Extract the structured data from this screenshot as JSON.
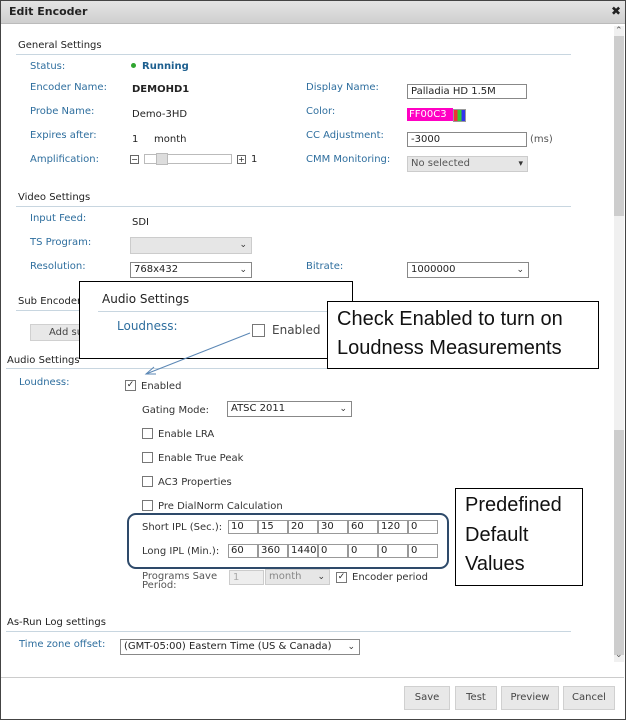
{
  "dialog": {
    "title": "Edit Encoder",
    "close_icon": "close-icon"
  },
  "general": {
    "title": "General Settings",
    "status_label": "Status:",
    "status_value": "Running",
    "status_color": "#2fa52f",
    "encoder_name_label": "Encoder Name:",
    "encoder_name_value": "DEMOHD1",
    "probe_name_label": "Probe Name:",
    "probe_name_value": "Demo-3HD",
    "expires_label": "Expires after:",
    "expires_value": "1",
    "expires_unit": "month",
    "amplification_label": "Amplification:",
    "amplification_value": "1",
    "display_name_label": "Display Name:",
    "display_name_value": "Palladia HD 1.5M",
    "color_label": "Color:",
    "color_value": "FF00C3",
    "color_hex": "#ff00c3",
    "cc_label": "CC Adjustment:",
    "cc_value": "-3000",
    "cc_unit": "(ms)",
    "cmm_label": "CMM Monitoring:",
    "cmm_value": "No selected"
  },
  "video": {
    "title": "Video Settings",
    "input_feed_label": "Input Feed:",
    "input_feed_value": "SDI",
    "ts_program_label": "TS Program:",
    "ts_program_value": "",
    "resolution_label": "Resolution:",
    "resolution_value": "768x432",
    "bitrate_label": "Bitrate:",
    "bitrate_value": "1000000"
  },
  "sub_encoders": {
    "title": "Sub Encoders",
    "add_button": "Add sub"
  },
  "audio": {
    "title": "Audio Settings",
    "loudness_label": "Loudness:",
    "enabled_label": "Enabled",
    "enabled_checked": true,
    "gating_mode_label": "Gating Mode:",
    "gating_mode_value": "ATSC 2011",
    "options": [
      {
        "label": "Enable LRA",
        "checked": false
      },
      {
        "label": "Enable True Peak",
        "checked": false
      },
      {
        "label": "AC3 Properties",
        "checked": false
      },
      {
        "label": "Pre DialNorm Calculation",
        "checked": false
      }
    ],
    "short_ipl_label": "Short IPL (Sec.):",
    "short_ipl_values": [
      "10",
      "15",
      "20",
      "30",
      "60",
      "120",
      "0"
    ],
    "long_ipl_label": "Long IPL (Min.):",
    "long_ipl_values": [
      "60",
      "360",
      "1440",
      "0",
      "0",
      "0",
      "0"
    ],
    "programs_save_label": "Programs Save Period:",
    "programs_save_value": "1",
    "programs_save_unit": "month",
    "encoder_period_label": "Encoder period",
    "encoder_period_checked": true
  },
  "asrun": {
    "title": "As-Run Log settings",
    "tz_label": "Time zone offset:",
    "tz_value": "(GMT-05:00) Eastern Time (US & Canada)"
  },
  "footer": {
    "save": "Save",
    "test": "Test",
    "preview": "Preview",
    "cancel": "Cancel"
  },
  "callouts": {
    "inset_title": "Audio Settings",
    "inset_loudness": "Loudness:",
    "inset_enabled": "Enabled",
    "check_enabled_text_1": "Check Enabled to turn on",
    "check_enabled_text_2": "Loudness Measurements",
    "predefined_1": "Predefined",
    "predefined_2": "Default",
    "predefined_3": "Values"
  }
}
